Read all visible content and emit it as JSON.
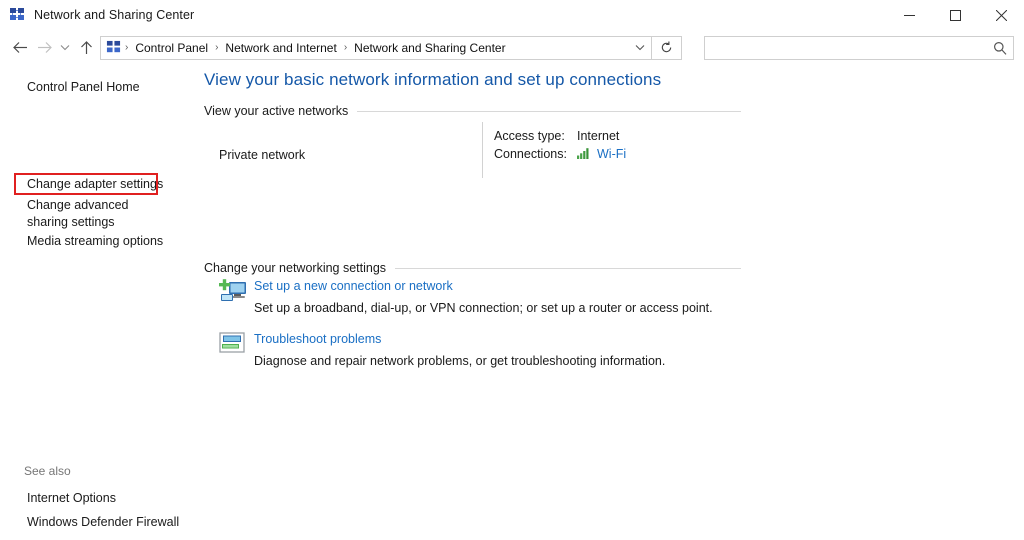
{
  "window": {
    "title": "Network and Sharing Center",
    "title_icon": "network-icon",
    "minimize_label": "–",
    "maximize_label": "□",
    "close_label": "✕"
  },
  "toolbar": {
    "back_icon": "arrow-left-icon",
    "forward_icon": "arrow-right-icon",
    "history_icon": "chevron-down-icon",
    "up_icon": "arrow-up-icon",
    "breadcrumb_icon": "network-icon",
    "breadcrumbs": [
      "Control Panel",
      "Network and Internet",
      "Network and Sharing Center"
    ],
    "separator": "›",
    "address_dropdown_icon": "chevron-down-icon",
    "refresh_icon": "refresh-icon",
    "search": {
      "value": "",
      "placeholder": "",
      "icon": "search-icon"
    }
  },
  "sidebar": {
    "items": [
      {
        "label": "Control Panel Home"
      },
      {
        "label": "Change adapter settings"
      },
      {
        "label": "Change advanced sharing settings"
      },
      {
        "label": "Media streaming options"
      }
    ],
    "highlight": {
      "target": "Change adapter settings",
      "color": "#e02020"
    },
    "see_also": {
      "title": "See also",
      "items": [
        {
          "label": "Internet Options"
        },
        {
          "label": "Windows Defender Firewall"
        }
      ]
    }
  },
  "main": {
    "page_title": "View your basic network information and set up connections",
    "sections": [
      {
        "heading": "View your active networks"
      },
      {
        "heading": "Change your networking settings"
      }
    ],
    "active_network": {
      "name": "Private network",
      "details": [
        {
          "key": "Access type:",
          "value": "Internet",
          "is_link": false
        },
        {
          "key": "Connections:",
          "value": "Wi-Fi",
          "is_link": true,
          "icon": "wifi-signal-icon"
        }
      ]
    },
    "actions": [
      {
        "icon": "new-connection-icon",
        "link": "Set up a new connection or network",
        "description": "Set up a broadband, dial-up, or VPN connection; or set up a router or access point."
      },
      {
        "icon": "troubleshoot-icon",
        "link": "Troubleshoot problems",
        "description": "Diagnose and repair network problems, or get troubleshooting information."
      }
    ]
  },
  "colors": {
    "title_blue": "#1558a8",
    "link_blue": "#1a6fc4",
    "highlight_red": "#e02020",
    "signal_green": "#3a9e3a"
  }
}
